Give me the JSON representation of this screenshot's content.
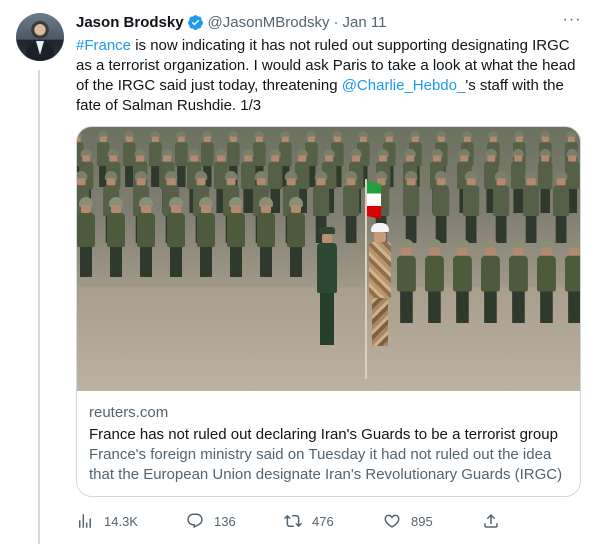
{
  "author": {
    "name": "Jason Brodsky",
    "handle": "@JasonMBrodsky",
    "separator": "·",
    "date": "Jan 11",
    "more_label": "···"
  },
  "tweet": {
    "hashtag": "#France",
    "text_part1": " is now indicating it has not ruled out supporting designating IRGC as a terrorist organization. I would ask Paris to take a look at what the head of the IRGC said just today, threatening ",
    "mention": "@Charlie_Hebdo_",
    "text_part2": "'s staff with the fate of Salman Rushdie. 1/3"
  },
  "card": {
    "domain": "reuters.com",
    "title": "France has not ruled out declaring Iran's Guards to be a terrorist group",
    "description_line1": "France's foreign ministry said on Tuesday it had not ruled out the idea",
    "description_line2": "that the European Union designate Iran's Revolutionary Guards (IRGC) ..."
  },
  "actions": {
    "views": "14.3K",
    "replies": "136",
    "retweets": "476",
    "likes": "895"
  },
  "icons": {
    "verified": "verified-badge-icon",
    "views": "analytics-icon",
    "reply": "reply-icon",
    "retweet": "retweet-icon",
    "like": "heart-icon",
    "share": "share-icon"
  },
  "colors": {
    "link": "#1d9bf0",
    "secondary_text": "#536471",
    "primary_text": "#0f1419",
    "border": "#cfd9de"
  }
}
